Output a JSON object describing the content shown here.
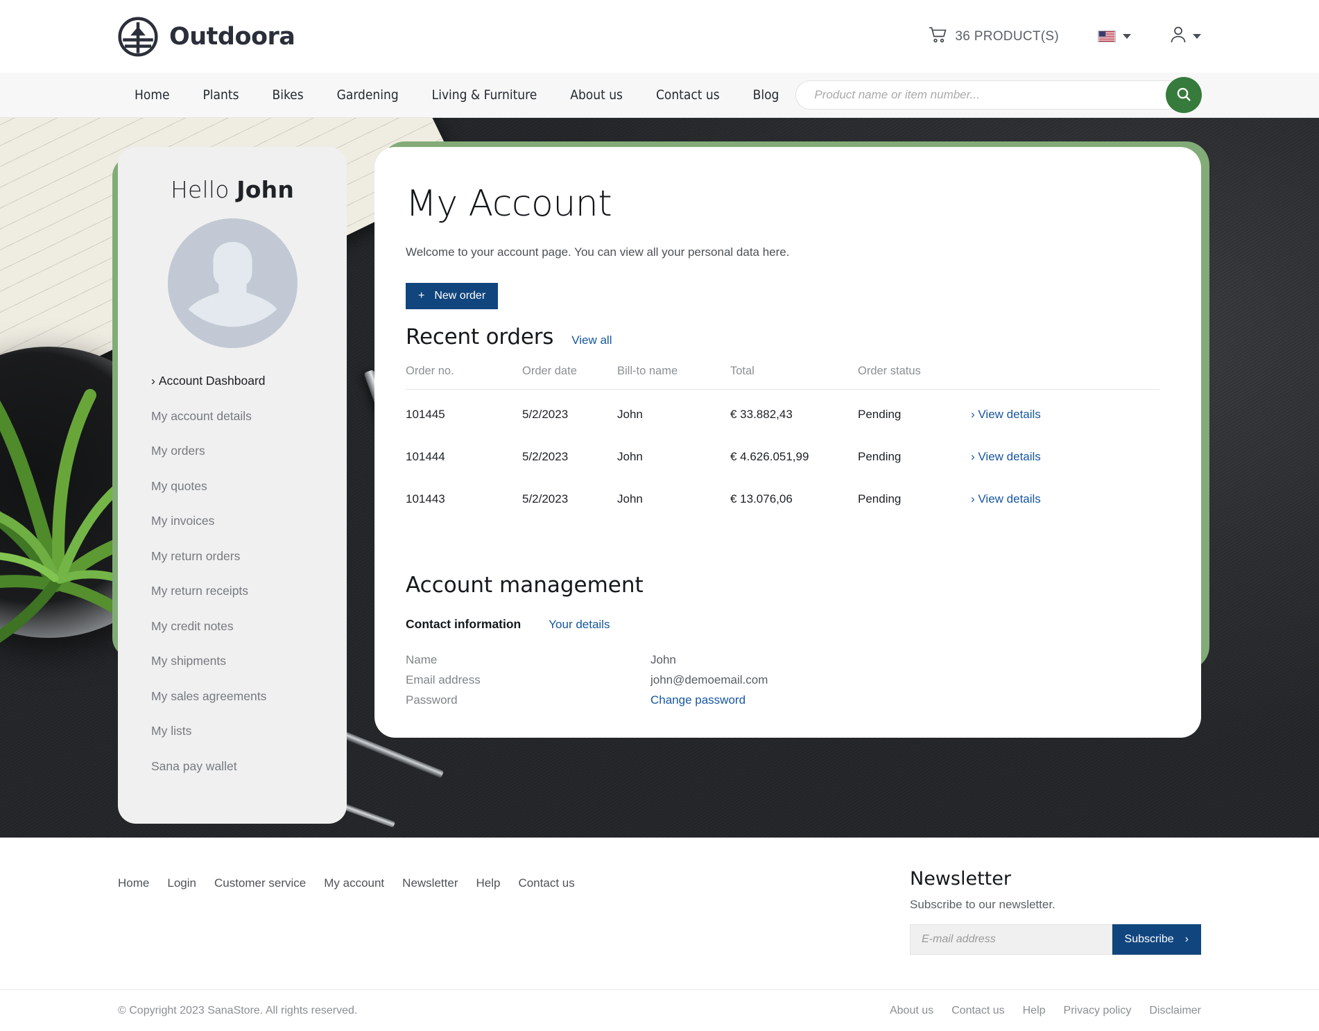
{
  "header": {
    "brand": "Outdoora",
    "brand_icon": "outdoora-circle-logo",
    "cart_icon": "shopping-cart-icon",
    "cart_label": "36 PRODUCT(S)",
    "flag_icon": "us-flag-icon",
    "user_icon": "user-account-icon"
  },
  "nav": {
    "items": [
      {
        "label": "Home"
      },
      {
        "label": "Plants"
      },
      {
        "label": "Bikes"
      },
      {
        "label": "Gardening"
      },
      {
        "label": "Living & Furniture"
      },
      {
        "label": "About us"
      },
      {
        "label": "Contact us"
      },
      {
        "label": "Blog"
      }
    ],
    "search": {
      "placeholder": "Product name or item number...",
      "value": "",
      "button_icon": "search-icon",
      "button_color": "#367a3c"
    }
  },
  "sidebar": {
    "greeting_prefix": "Hello ",
    "greeting_name": "John",
    "avatar_icon": "default-user-avatar",
    "items": [
      {
        "label": "Account Dashboard",
        "active": true
      },
      {
        "label": "My account details",
        "active": false
      },
      {
        "label": "My orders",
        "active": false
      },
      {
        "label": "My quotes",
        "active": false
      },
      {
        "label": "My invoices",
        "active": false
      },
      {
        "label": "My return orders",
        "active": false
      },
      {
        "label": "My return receipts",
        "active": false
      },
      {
        "label": "My credit notes",
        "active": false
      },
      {
        "label": "My shipments",
        "active": false
      },
      {
        "label": "My sales agreements",
        "active": false
      },
      {
        "label": "My lists",
        "active": false
      },
      {
        "label": "Sana pay wallet",
        "active": false
      }
    ]
  },
  "main": {
    "title": "My Account",
    "intro": "Welcome to your account page. You can view all your personal data here.",
    "new_order_button": "New order",
    "new_order_icon": "plus-icon",
    "recent_orders_title": "Recent orders",
    "view_all_label": "View all",
    "table": {
      "columns": [
        "Order no.",
        "Order date",
        "Bill-to name",
        "Total",
        "Order status",
        ""
      ],
      "rows": [
        {
          "order_no": "101445",
          "order_date": "5/2/2023",
          "bill_to": "John",
          "total": "€ 33.882,43",
          "status": "Pending",
          "details": "View details"
        },
        {
          "order_no": "101444",
          "order_date": "5/2/2023",
          "bill_to": "John",
          "total": "€ 4.626.051,99",
          "status": "Pending",
          "details": "View details"
        },
        {
          "order_no": "101443",
          "order_date": "5/2/2023",
          "bill_to": "John",
          "total": "€ 13.076,06",
          "status": "Pending",
          "details": "View details"
        }
      ]
    },
    "management_title": "Account management",
    "contact_information_label": "Contact information",
    "your_details_label": "Your details",
    "fields": [
      {
        "label": "Name",
        "value": "John",
        "is_link": false
      },
      {
        "label": "Email address",
        "value": "john@demoemail.com",
        "is_link": false
      },
      {
        "label": "Password",
        "value": "Change password",
        "is_link": true
      }
    ]
  },
  "footer": {
    "links": [
      {
        "label": "Home"
      },
      {
        "label": "Login"
      },
      {
        "label": "Customer service"
      },
      {
        "label": "My account"
      },
      {
        "label": "Newsletter"
      },
      {
        "label": "Help"
      },
      {
        "label": "Contact us"
      }
    ],
    "newsletter": {
      "title": "Newsletter",
      "subtitle": "Subscribe to our newsletter.",
      "placeholder": "E-mail address",
      "value": "",
      "button": "Subscribe",
      "button_icon": "chevron-right-icon"
    },
    "copyright": "© Copyright 2023 SanaStore. All rights reserved.",
    "legal": [
      {
        "label": "About us"
      },
      {
        "label": "Contact us"
      },
      {
        "label": "Help"
      },
      {
        "label": "Privacy policy"
      },
      {
        "label": "Disclaimer"
      }
    ]
  },
  "theme": {
    "accent_green": "#82ab78",
    "search_green": "#367a3c",
    "button_navy": "#11457e",
    "link_blue": "#15569f"
  }
}
